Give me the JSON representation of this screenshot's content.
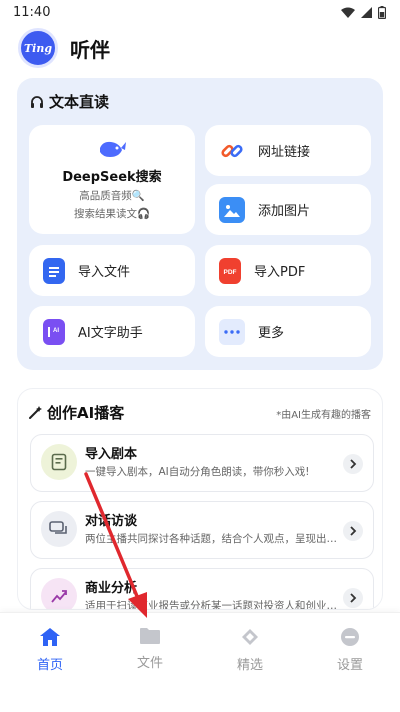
{
  "status_bar": {
    "time": "11:40"
  },
  "app": {
    "logo_text": "Ting",
    "name": "听伴"
  },
  "text_read": {
    "title": "文本直读",
    "deepseek": {
      "title": "DeepSeek搜索",
      "line1": "高品质音频🔍",
      "line2": "搜索结果读文🎧"
    },
    "tiles": [
      {
        "label": "网址链接",
        "icon": "link-icon"
      },
      {
        "label": "添加图片",
        "icon": "image-icon"
      },
      {
        "label": "导入文件",
        "icon": "file-icon"
      },
      {
        "label": "导入PDF",
        "icon": "pdf-icon"
      },
      {
        "label": "AI文字助手",
        "icon": "ai-text-icon"
      },
      {
        "label": "更多",
        "icon": "more-icon"
      }
    ]
  },
  "create_ai": {
    "title": "创作AI播客",
    "note": "*由AI生成有趣的播客",
    "items": [
      {
        "title": "导入剧本",
        "desc": "一键导入剧本，AI自动分角色朗读，带你秒入戏!"
      },
      {
        "title": "对话访谈",
        "desc": "两位主播共同探讨各种话题，结合个人观点，呈现出…"
      },
      {
        "title": "商业分析",
        "desc": "适用于扫读商业报告或分析某一话题对投资人和创业…"
      }
    ]
  },
  "nav": {
    "items": [
      {
        "label": "首页",
        "active": true
      },
      {
        "label": "文件",
        "active": false
      },
      {
        "label": "精选",
        "active": false
      },
      {
        "label": "设置",
        "active": false
      }
    ]
  },
  "colors": {
    "accent": "#2f63f5",
    "card_bg": "#e9effb",
    "annotation": "#e0282e"
  }
}
